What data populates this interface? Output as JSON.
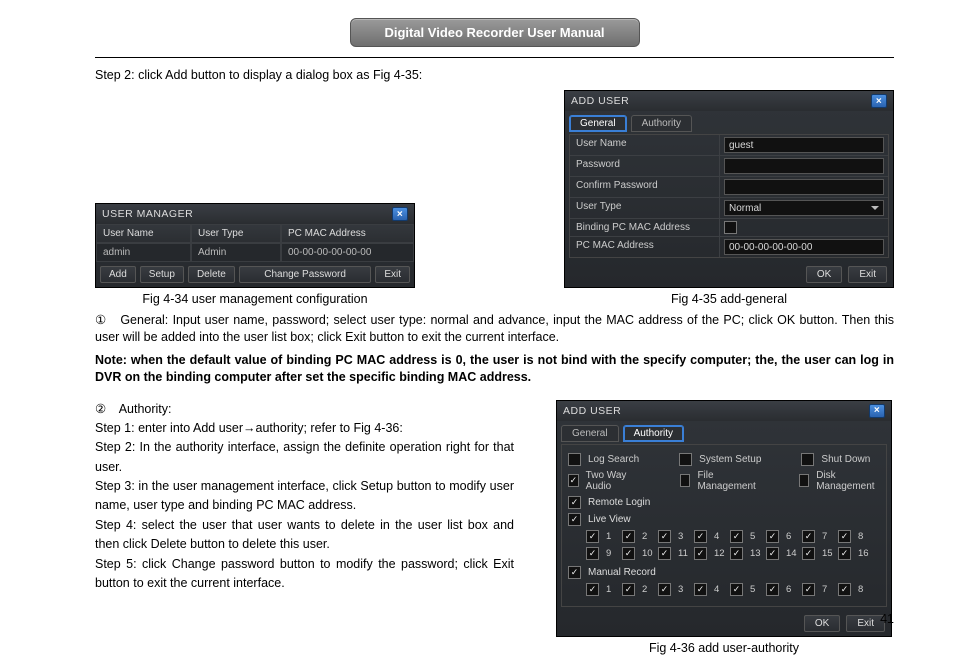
{
  "header": {
    "title": "Digital Video Recorder User Manual"
  },
  "intro": {
    "step2": "Step 2: click Add button to display a dialog box as Fig 4-35:"
  },
  "fig34": {
    "title": "USER  MANAGER",
    "headers": {
      "c1": "User Name",
      "c2": "User Type",
      "c3": "PC MAC Address"
    },
    "row": {
      "c1": "admin",
      "c2": "Admin",
      "c3": "00-00-00-00-00-00"
    },
    "buttons": {
      "add": "Add",
      "setup": "Setup",
      "delete": "Delete",
      "change": "Change Password",
      "exit": "Exit"
    },
    "caption": "Fig 4-34 user management configuration"
  },
  "fig35": {
    "title": "ADD  USER",
    "tabs": {
      "general": "General",
      "authority": "Authority"
    },
    "rows": {
      "username_lbl": "User Name",
      "username_val": "guest",
      "password_lbl": "Password",
      "confirm_lbl": "Confirm  Password",
      "type_lbl": "User  Type",
      "type_val": "Normal",
      "bind_lbl": "Binding PC MAC Address",
      "mac_lbl": "PC MAC Address",
      "mac_val": "00-00-00-00-00-00"
    },
    "buttons": {
      "ok": "OK",
      "exit": "Exit"
    },
    "caption": "Fig 4-35 add-general"
  },
  "text": {
    "p1a": "①　General: Input user name, password; select user type: normal and advance, input the MAC address of the PC; click OK button. Then this user will be added into the user list box; click Exit button to exit the current interface.",
    "note": "Note: when the default value of binding PC MAC address is 0, the user is not bind with the specify computer; the, the user can log in DVR on the binding computer after set the specific binding MAC address.",
    "p2": "②　Authority:",
    "s1a": "Step 1: enter into Add user",
    "s1b": "authority; refer to Fig 4-36:",
    "s2": "Step 2: In the authority interface, assign the definite operation right for that user.",
    "s3": "Step 3: in the user management interface, click Setup button to modify user name, user type and binding PC MAC address.",
    "s4": "Step 4: select the user that user wants to delete in the user list box and then click Delete button to delete this user.",
    "s5": "Step 5: click Change password button to modify the password; click Exit button to exit the current interface."
  },
  "fig36": {
    "title": "ADD USER",
    "tabs": {
      "general": "General",
      "authority": "Authority"
    },
    "opts": {
      "log": "Log Search",
      "sys": "System Setup",
      "shut": "Shut Down",
      "two": "Two Way Audio",
      "file": "File Management",
      "disk": "Disk Management",
      "remote": "Remote Login",
      "live": "Live View",
      "manual": "Manual Record"
    },
    "nums": [
      "1",
      "2",
      "3",
      "4",
      "5",
      "6",
      "7",
      "8",
      "9",
      "10",
      "11",
      "12",
      "13",
      "14",
      "15",
      "16"
    ],
    "buttons": {
      "ok": "OK",
      "exit": "Exit"
    },
    "caption": "Fig 4-36 add user-authority"
  },
  "page": "41"
}
